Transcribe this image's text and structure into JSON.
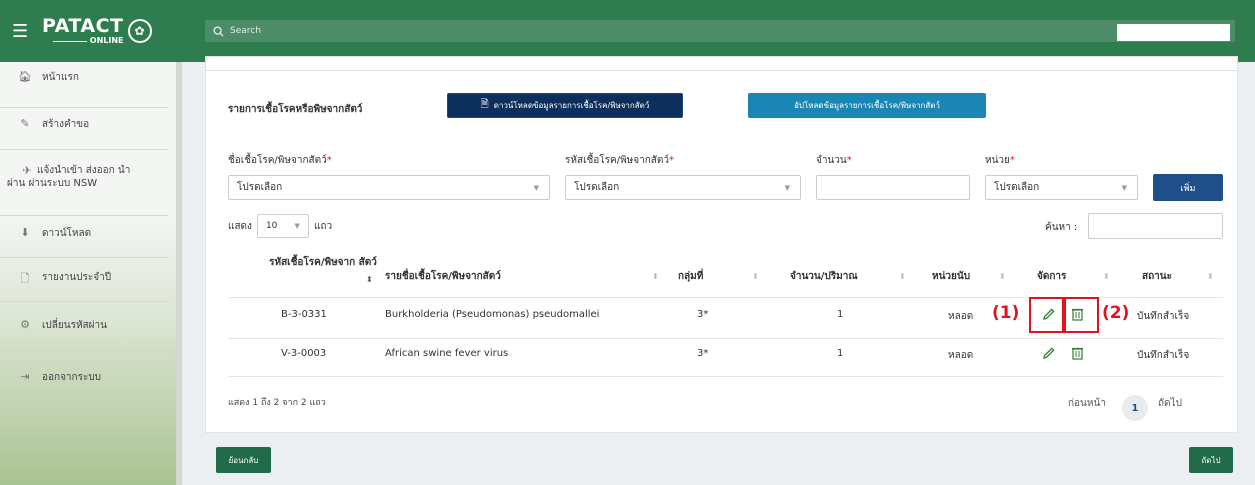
{
  "header": {
    "logo_main": "PATACT",
    "logo_sub": "ONLINE",
    "search_placeholder": "Search"
  },
  "sidebar": {
    "items": [
      {
        "icon": "home-icon",
        "label": "หน้าแรก"
      },
      {
        "icon": "pencil-icon",
        "label": "สร้างคำขอ"
      },
      {
        "icon": "airplane-icon",
        "label": "แจ้งนำเข้า ส่งออก นำผ่าน ผ่านระบบ NSW"
      },
      {
        "icon": "download-icon",
        "label": "ดาวน์โหลด"
      },
      {
        "icon": "file-icon",
        "label": "รายงานประจำปี"
      },
      {
        "icon": "gears-icon",
        "label": "เปลี่ยนรหัสผ่าน"
      },
      {
        "icon": "sign-out-icon",
        "label": "ออกจากระบบ"
      }
    ]
  },
  "main": {
    "section_title": "รายการเชื้อโรคหรือพิษจากสัตว์",
    "download_button": "ดาวน์โหลดข้อมูลรายการเชื้อโรค/พิษจากสัตว์",
    "upload_button": "อัปโหลดข้อมูลรายการเชื้อโรค/พิษจากสัตว์",
    "form": {
      "pathogen_label": "ชื่อเชื้อโรค/พิษจากสัตว์",
      "pathogen_value": "โปรดเลือก",
      "code_label": "รหัสเชื้อโรค/พิษจากสัตว์",
      "code_value": "โปรดเลือก",
      "amount_label": "จำนวน",
      "amount_value": "",
      "unit_label": "หน่วย",
      "unit_value": "โปรดเลือก",
      "required_mark": "*",
      "add_button": "เพิ่ม"
    },
    "table_controls": {
      "show_label": "แสดง",
      "page_length": "10",
      "rows_label": "แถว",
      "search_label": "ค้นหา :"
    },
    "table": {
      "headers": {
        "code": "รหัสเชื้อโรค/พิษจาก สัตว์",
        "name": "รายชื่อเชื้อโรค/พิษจากสัตว์",
        "group": "กลุ่มที่",
        "quantity": "จำนวน/ปริมาณ",
        "unit": "หน่วยนับ",
        "manage": "จัดการ",
        "status": "สถานะ"
      },
      "rows": [
        {
          "code": "B-3-0331",
          "name": "Burkholderia (Pseudomonas) pseudomallei",
          "group": "3*",
          "quantity": "1",
          "unit": "หลอด",
          "status": "บันทึกสำเร็จ"
        },
        {
          "code": "V-3-0003",
          "name": "African swine fever virus",
          "group": "3*",
          "quantity": "1",
          "unit": "หลอด",
          "status": "บันทึกสำเร็จ"
        }
      ]
    },
    "annotations": {
      "edit_marker": "(1)",
      "delete_marker": "(2)"
    },
    "info": "แสดง 1 ถึง 2 จาก 2 แถว",
    "pagination": {
      "prev": "ก่อนหน้า",
      "current": "1",
      "next": "ถัดไป"
    }
  },
  "footer": {
    "back_button": "ย้อนกลับ",
    "next_button": "ถัดไป"
  },
  "colors": {
    "header_green": "#2e7d4f",
    "download_navy": "#0d2f5c",
    "upload_blue": "#1a86b3",
    "action_green": "#2e7d32",
    "highlight_red": "#e0141e"
  }
}
